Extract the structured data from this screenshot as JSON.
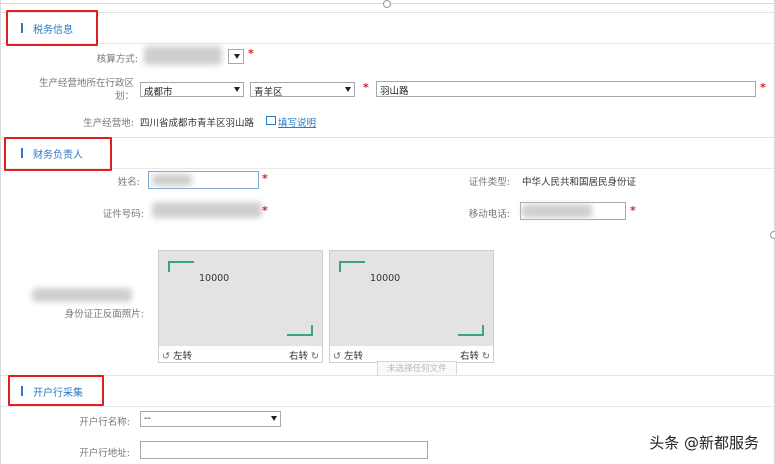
{
  "tax_section": {
    "title": "税务信息",
    "accounting_method_label": "核算方式:",
    "admin_region_label": "生产经营地所在行政区划：",
    "city": "成都市",
    "district": "青羊区",
    "street": "羽山路",
    "business_address_label": "生产经营地:",
    "business_address": "四川省成都市青羊区羽山路",
    "fill_guide_link": "填写说明"
  },
  "finance_section": {
    "title": "财务负责人",
    "name_label": "姓名:",
    "id_type_label": "证件类型:",
    "id_type_value": "中华人民共和国居民身份证",
    "id_number_label": "证件号码:",
    "mobile_label": "移动电话:",
    "photo_label": "身份证正反面照片:",
    "photo_front_text": "10000",
    "photo_back_text": "10000",
    "rotate_left": "左转",
    "rotate_right": "右转",
    "no_file_tooltip": "未选择任何文件"
  },
  "bank_section": {
    "title": "开户行采集",
    "bank_name_label": "开户行名称:",
    "bank_name_value": "--",
    "bank_address_label": "开户行地址:"
  },
  "watermark": "头条 @新都服务",
  "colors": {
    "accent": "#2b78c5",
    "required": "#e0202a",
    "highlight_box": "#e02020",
    "photo_corner": "#3aa57a"
  }
}
